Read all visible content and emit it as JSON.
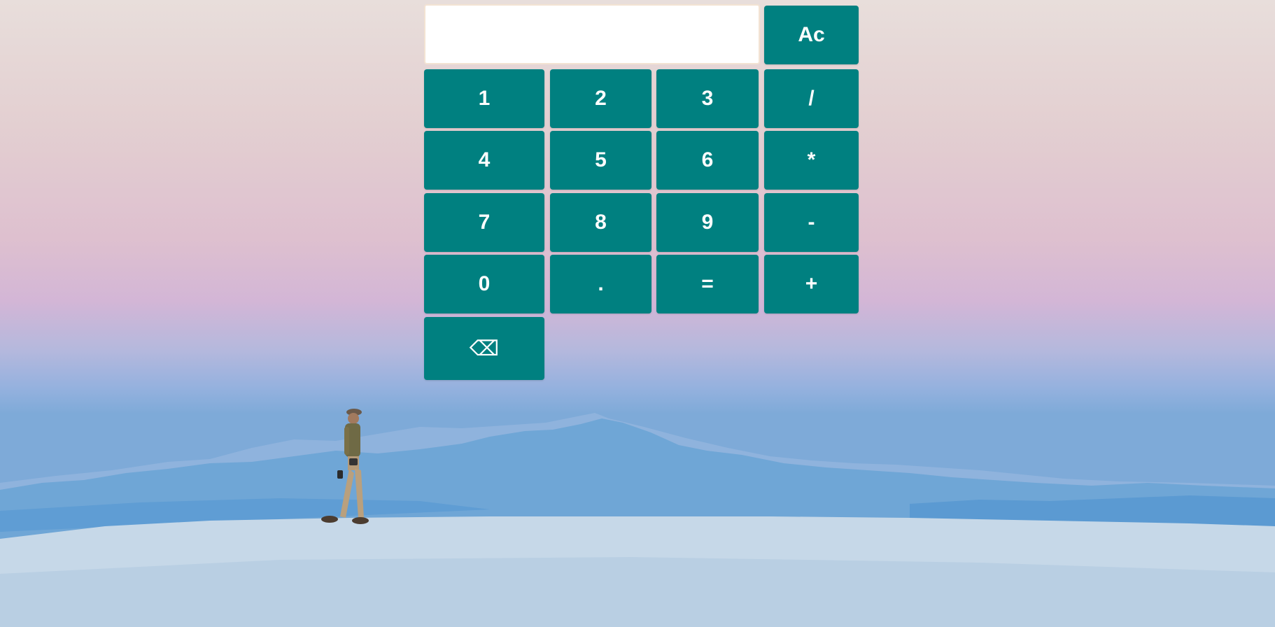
{
  "calculator": {
    "display_value": "",
    "clear_label": "Ac",
    "keys": {
      "one": "1",
      "two": "2",
      "three": "3",
      "divide": "/",
      "four": "4",
      "five": "5",
      "six": "6",
      "multiply": "*",
      "seven": "7",
      "eight": "8",
      "nine": "9",
      "subtract": "-",
      "zero": "0",
      "decimal": ".",
      "equals": "=",
      "add": "+",
      "backspace": "⌫"
    },
    "button_color": "#008080",
    "button_text_color": "#ffffff"
  },
  "background": {
    "icon": "desert-landscape-photo",
    "sky_top_color": "#e8dedb",
    "sky_mid_color": "#dec0cf",
    "mountain_color": "#6fa6d6",
    "ground_color": "#c4d6e6"
  }
}
